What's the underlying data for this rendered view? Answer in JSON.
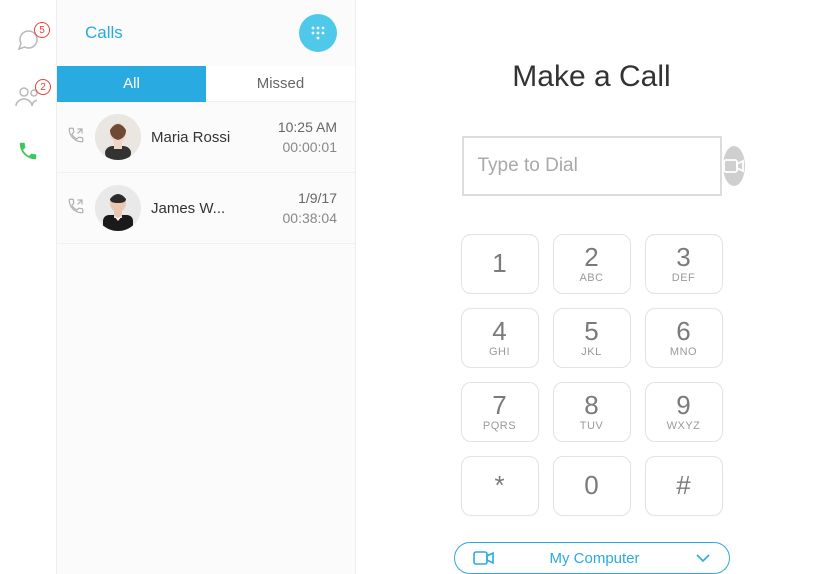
{
  "nav": {
    "chat_badge": "5",
    "contacts_badge": "2"
  },
  "panel": {
    "title": "Calls",
    "tabs": {
      "all": "All",
      "missed": "Missed"
    }
  },
  "calls": [
    {
      "name": "Maria Rossi",
      "time": "10:25 AM",
      "duration": "00:00:01"
    },
    {
      "name": "James W...",
      "time": "1/9/17",
      "duration": "00:38:04"
    }
  ],
  "dialer": {
    "title": "Make a Call",
    "placeholder": "Type to Dial",
    "device": "My Computer",
    "keys": [
      {
        "d": "1",
        "l": ""
      },
      {
        "d": "2",
        "l": "ABC"
      },
      {
        "d": "3",
        "l": "DEF"
      },
      {
        "d": "4",
        "l": "GHI"
      },
      {
        "d": "5",
        "l": "JKL"
      },
      {
        "d": "6",
        "l": "MNO"
      },
      {
        "d": "7",
        "l": "PQRS"
      },
      {
        "d": "8",
        "l": "TUV"
      },
      {
        "d": "9",
        "l": "WXYZ"
      },
      {
        "d": "*",
        "l": ""
      },
      {
        "d": "0",
        "l": ""
      },
      {
        "d": "#",
        "l": ""
      }
    ]
  }
}
